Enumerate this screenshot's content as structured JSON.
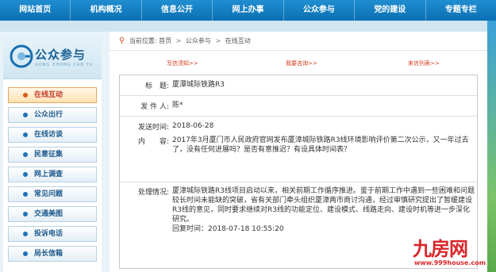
{
  "nav": {
    "items": [
      "网站首页",
      "机构概况",
      "信息公开",
      "网上办事",
      "公众参与",
      "党的建设",
      "专题专栏"
    ]
  },
  "sidebar": {
    "title": "公众参与",
    "subtitle": "GONG ZHONG CAN YU",
    "items": [
      {
        "label": "在线互动",
        "active": true
      },
      {
        "label": "公众出行",
        "active": false
      },
      {
        "label": "在线访谈",
        "active": false
      },
      {
        "label": "民意征集",
        "active": false
      },
      {
        "label": "网上调查",
        "active": false
      },
      {
        "label": "常见问题",
        "active": false
      },
      {
        "label": "交通美图",
        "active": false
      },
      {
        "label": "投诉电话",
        "active": false
      },
      {
        "label": "局长信箱",
        "active": false
      }
    ]
  },
  "breadcrumb": {
    "prefix": "当前位置:",
    "items": [
      "首页",
      "公众参与",
      "在线互动"
    ]
  },
  "links": {
    "write": "写信须知>>",
    "ask": "我要咨询>>",
    "list": "来信列表>>"
  },
  "detail": {
    "title_label": "标　题:",
    "title_value": "厦潭城际铁路R3",
    "sender_label": "发 件 人:",
    "sender_value": "陈*",
    "time_label": "发送时间:",
    "time_value": "2018-06-28",
    "content_label": "内　　容:",
    "content_value": "2017年3月厦门市人民政府官网发布厦漳城际铁路R3线环境影响评价第二次公示，又一年过去了，没有任何进展吗？是否有意推迟？有设具体时间表？",
    "handling_label": "处理情况:",
    "handling_value": "厦漳城际铁路R3线项目启动以来，相关前期工作循序推进。鉴于前期工作中遇到一些困难和问题较长时间未能缺的突破，省有关部门牵头组织厦漳两市商讨沟通，经过审慎研究提出了暂缓建设R3线的意见，同时要求继续对R3线的功能定位、建设模式、线路走向、建设时机等进一步深化研究。",
    "reply_time": "回复时间：2018-07-18 10:55:20"
  },
  "watermark": {
    "brand": "九房网",
    "url": "www.999house.com"
  },
  "colors": {
    "nav_bg": "#0b6fb4",
    "accent_red": "#d23c1c",
    "active_item": "#ffe1b0"
  }
}
